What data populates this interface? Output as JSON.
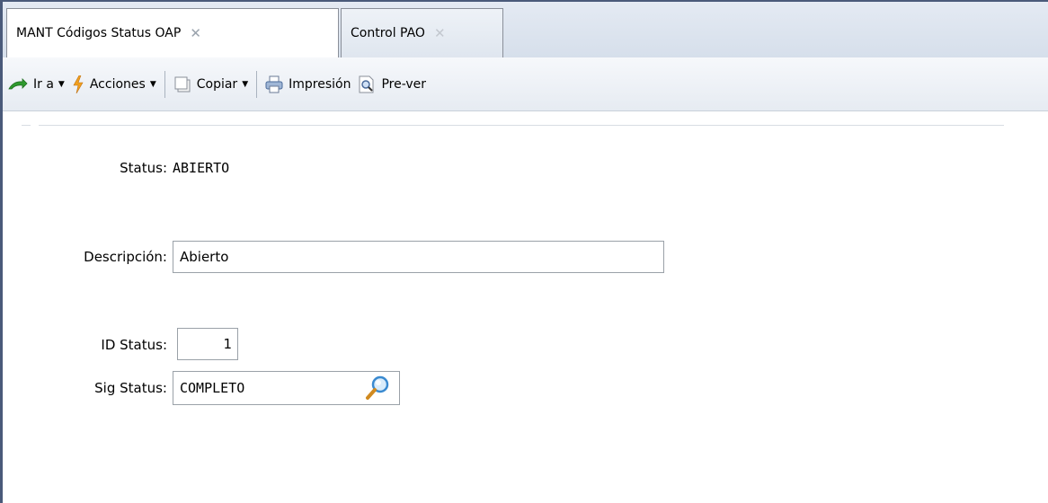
{
  "tabs": [
    {
      "label": "MANT Códigos Status OAP",
      "close": "✕",
      "active": true
    },
    {
      "label": "Control PAO",
      "close": "✕",
      "active": false
    }
  ],
  "toolbar": {
    "goto_label": "Ir a",
    "actions_label": "Acciones",
    "copy_label": "Copiar",
    "print_label": "Impresión",
    "preview_label": "Pre-ver"
  },
  "form": {
    "status_label": "Status:",
    "status_value": "ABIERTO",
    "description_label": "Descripción:",
    "description_value": "Abierto",
    "id_label": "ID Status:",
    "id_value": "1",
    "next_label": "Sig Status:",
    "next_value": "COMPLETO"
  },
  "colors": {
    "frame": "#4a5a7a",
    "goto_icon": "#2e9a2e",
    "actions_icon": "#f0a020"
  }
}
